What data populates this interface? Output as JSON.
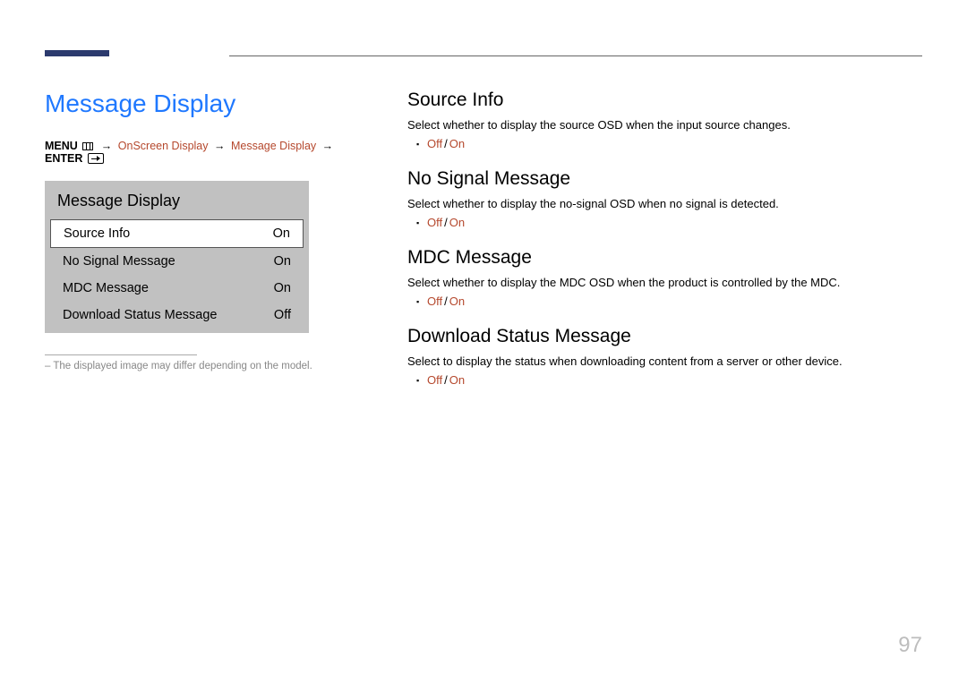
{
  "page_number": "97",
  "left": {
    "title": "Message Display",
    "breadcrumb": {
      "menu": "MENU",
      "path1": "OnScreen Display",
      "path2": "Message Display",
      "enter": "ENTER"
    },
    "osd": {
      "title": "Message Display",
      "rows": [
        {
          "label": "Source Info",
          "value": "On",
          "selected": true
        },
        {
          "label": "No Signal Message",
          "value": "On",
          "selected": false
        },
        {
          "label": "MDC Message",
          "value": "On",
          "selected": false
        },
        {
          "label": "Download Status Message",
          "value": "Off",
          "selected": false
        }
      ]
    },
    "note": "– The displayed image may differ depending on the model."
  },
  "right": {
    "sections": [
      {
        "heading": "Source Info",
        "body": "Select whether to display the source OSD when the input source changes.",
        "opt1": "Off",
        "opt2": "On"
      },
      {
        "heading": "No Signal Message",
        "body": "Select whether to display the no-signal OSD when no signal is detected.",
        "opt1": "Off",
        "opt2": "On"
      },
      {
        "heading": "MDC Message",
        "body": "Select whether to display the MDC OSD when the product is controlled by the MDC.",
        "opt1": "Off",
        "opt2": "On"
      },
      {
        "heading": "Download Status Message",
        "body": "Select to display the status when downloading content from a server or other device.",
        "opt1": "Off",
        "opt2": "On"
      }
    ]
  }
}
